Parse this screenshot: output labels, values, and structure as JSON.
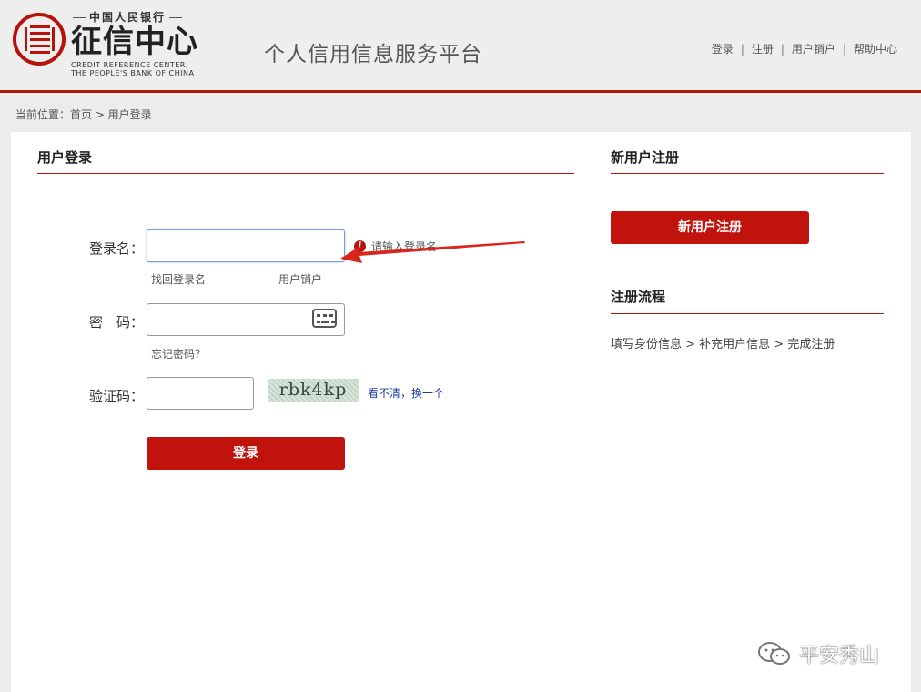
{
  "header": {
    "logo_top": "中国人民银行",
    "logo_main": "征信中心",
    "logo_en_line1": "CREDIT REFERENCE CENTER,",
    "logo_en_line2": "THE PEOPLE'S BANK OF CHINA",
    "platform_title": "个人信用信息服务平台",
    "nav": [
      "登录",
      "注册",
      "用户销户",
      "帮助中心"
    ],
    "nav_separator": "|"
  },
  "breadcrumb": "当前位置：首页 > 用户登录",
  "login": {
    "section_title": "用户登录",
    "username_label": "登录名：",
    "username_value": "",
    "username_hint": "请输入登录名",
    "retrieve_username": "找回登录名",
    "cancel_account": "用户销户",
    "password_label": "密　码：",
    "password_value": "",
    "forgot_password": "忘记密码？",
    "captcha_label": "验证码：",
    "captcha_value": "",
    "captcha_text": "rbk4kp",
    "captcha_refresh": "看不清，换一个",
    "submit_label": "登录"
  },
  "register": {
    "section_title": "新用户注册",
    "button_label": "新用户注册",
    "flow_title": "注册流程",
    "flow_text": "填写身份信息 > 补充用户信息 > 完成注册"
  },
  "watermark": "平安秀山",
  "colors": {
    "brand_red": "#b5140c",
    "button_red": "#c0130b",
    "link_blue": "#1a3f9a"
  }
}
